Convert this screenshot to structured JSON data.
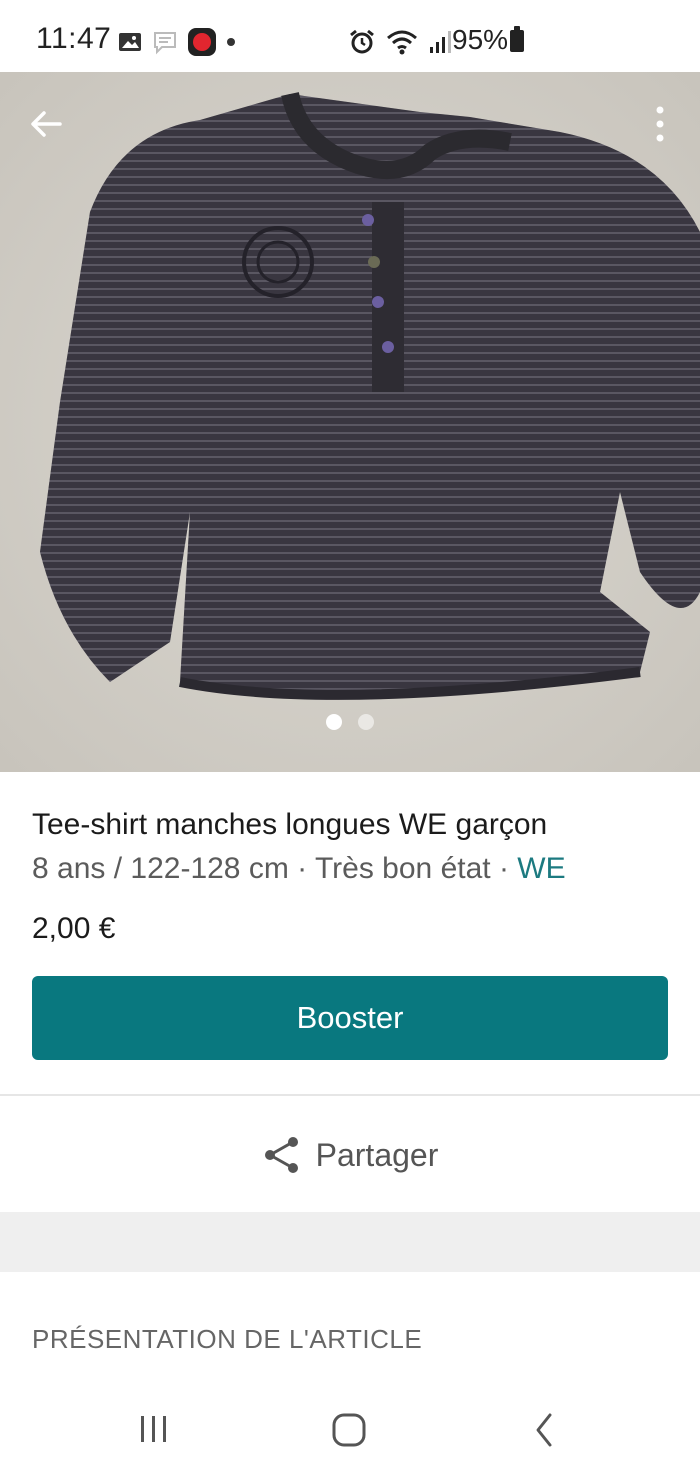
{
  "status_bar": {
    "time": "11:47",
    "battery": "95%",
    "icons_left": [
      "image-icon",
      "chat-bubble-icon",
      "app-notification-icon",
      "dot-icon"
    ],
    "icons_right": [
      "alarm-icon",
      "wifi-icon",
      "signal-icon"
    ]
  },
  "product": {
    "title": "Tee-shirt  manches longues WE garçon",
    "size": "8 ans / 122-128 cm",
    "condition": "Très bon état",
    "brand": "WE",
    "separator": " · ",
    "price": "2,00 €"
  },
  "actions": {
    "boost_label": "Booster",
    "share_label": "Partager"
  },
  "sections": {
    "presentation_title": "PRÉSENTATION DE L'ARTICLE"
  },
  "gallery": {
    "image_count": 2,
    "active_index": 0
  },
  "colors": {
    "accent": "#09787f",
    "brand_link": "#1c7a80",
    "shirt": "#3f3c47"
  }
}
